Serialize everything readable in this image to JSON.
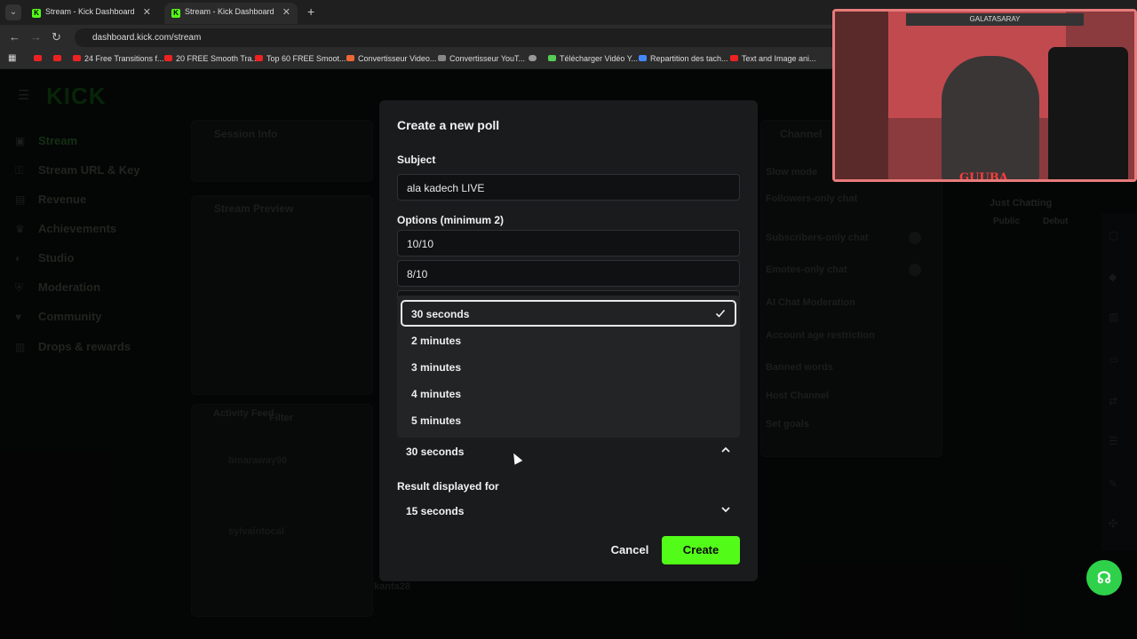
{
  "browser": {
    "tabs": [
      {
        "title": "Stream - Kick Dashboard",
        "state": "inactive"
      },
      {
        "title": "Stream - Kick Dashboard",
        "state": "active"
      }
    ],
    "url": "dashboard.kick.com/stream",
    "bookmarks": [
      "24 Free Transitions f...",
      "20 FREE Smooth Tra...",
      "Top 60 FREE Smoot...",
      "Convertisseur Video...",
      "Convertisseur YouT...",
      "Télécharger Vidéo Y...",
      "Repartition des tach...",
      "Text and Image ani..."
    ]
  },
  "dashboard": {
    "logo": "KICK",
    "sidebar": [
      "Stream",
      "Stream URL & Key",
      "Revenue",
      "Achievements",
      "Studio",
      "Moderation",
      "Community",
      "Drops & rewards"
    ],
    "session_info": "Session Info",
    "stream_preview": "Stream Preview",
    "activity_feed": "Activity Feed",
    "filter": "Filter",
    "channel_settings": "Channel",
    "settings_items": [
      "Slow mode",
      "Followers-only chat",
      "Subscribers-only chat",
      "Emotes-only chat",
      "AI Chat Moderation",
      "Account age restriction",
      "Banned words",
      "Host Channel",
      "Set goals"
    ],
    "feed_users": [
      "bmaraway90",
      "sylvaintocal",
      "kanta28"
    ],
    "chat_tab": "Just Chatting",
    "chat_options": [
      "Public",
      "Debut"
    ]
  },
  "webcam": {
    "label": "GUUBA",
    "scarf": "GALATASARAY"
  },
  "poll_modal": {
    "title": "Create a new poll",
    "subject_label": "Subject",
    "subject_value": "ala kadech LIVE",
    "options_label": "Options (minimum 2)",
    "options": [
      "10/10",
      "8/10"
    ],
    "duration_selected": "30 seconds",
    "duration_options": [
      "30 seconds",
      "2 minutes",
      "3 minutes",
      "4 minutes",
      "5 minutes"
    ],
    "result_label": "Result displayed for",
    "result_selected": "15 seconds",
    "cancel_label": "Cancel",
    "create_label": "Create"
  },
  "colors": {
    "accent": "#53fc18",
    "modal_bg": "#191b1c",
    "support": "#2fd14a"
  }
}
